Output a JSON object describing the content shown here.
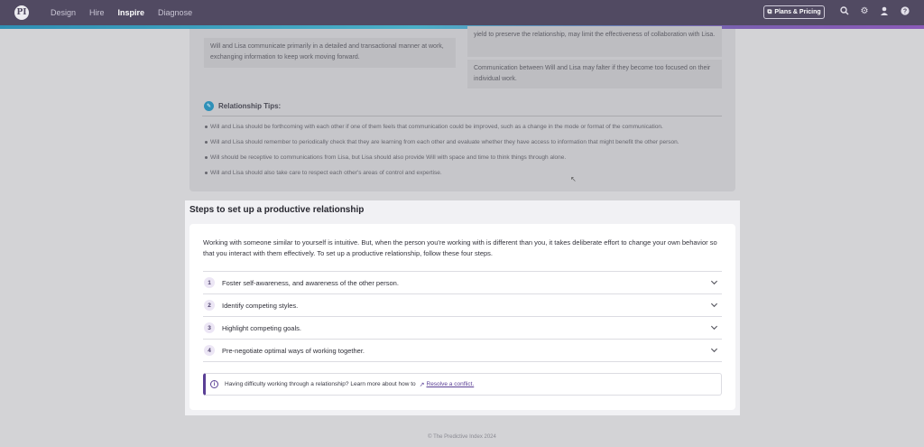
{
  "topbar": {
    "logo_text": "PI",
    "nav": [
      "Design",
      "Hire",
      "Inspire",
      "Diagnose"
    ],
    "active_nav": "Inspire",
    "plans_button": "Plans & Pricing",
    "icons": [
      "search-icon",
      "gear-icon",
      "user-icon",
      "help-icon"
    ]
  },
  "upper": {
    "cell_left": "Will and Lisa communicate primarily in a detailed and transactional manner at work, exchanging information to keep work moving forward.",
    "cell_right_top": "yield to preserve the relationship, may limit the effectiveness of collaboration with Lisa.",
    "cell_right_bottom": "Communication between Will and Lisa may falter if they become too focused on their individual work.",
    "tips_title": "Relationship Tips:",
    "tips": [
      "Will and Lisa should be forthcoming with each other if one of them feels that communication could be improved, such as a change in the mode or format of the communication.",
      "Will and Lisa should remember to periodically check that they are learning from each other and evaluate whether they have access to information that might benefit the other person.",
      "Will should be receptive to communications from Lisa, but Lisa should also provide Will with space and time to think things through alone.",
      "Will and Lisa should also take care to respect each other's areas of control and expertise."
    ]
  },
  "steps": {
    "title": "Steps to set up a productive relationship",
    "intro": "Working with someone similar to yourself is intuitive. But, when the person you're working with is different than you, it takes deliberate effort to change your own behavior so that you interact with them effectively. To set up a productive relationship, follow these four steps.",
    "items": [
      {
        "num": "1",
        "label": "Foster self-awareness, and awareness of the other person."
      },
      {
        "num": "2",
        "label": "Identify competing styles."
      },
      {
        "num": "3",
        "label": "Highlight competing goals."
      },
      {
        "num": "4",
        "label": "Pre-negotiate optimal ways of working together."
      }
    ],
    "callout_text": "Having difficulty working through a relationship? Learn more about how to",
    "callout_link": "Resolve a conflict."
  },
  "footer": "© The Predictive Index 2024",
  "colors": {
    "nav_bg": "#514a62",
    "accent_purple": "#5a3f95",
    "tips_icon": "#2e90b8"
  }
}
